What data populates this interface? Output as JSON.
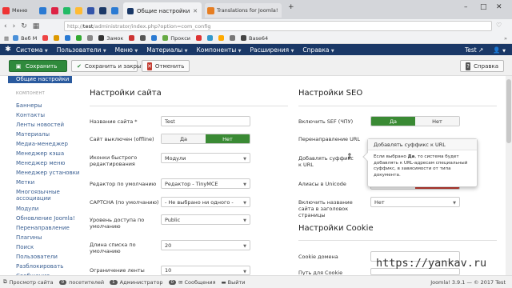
{
  "browser": {
    "tabs_small": [
      {
        "label": "Меню",
        "color": "#e33"
      },
      {
        "label": "",
        "color": "#2a7ad3"
      },
      {
        "label": "",
        "color": "#d24"
      },
      {
        "label": "",
        "color": "#2b6"
      },
      {
        "label": "",
        "color": "#fb3"
      },
      {
        "label": "",
        "color": "#35a"
      },
      {
        "label": "",
        "color": "#1a3867"
      },
      {
        "label": "",
        "color": "#2a7ad3"
      }
    ],
    "tab_active": "Общие настройки ‹ Test",
    "tab_second": "Translations for Joomla!",
    "address_host": "test",
    "address_path": "/administrator/index.php?option=com_config",
    "bookmarks": [
      "Веб М",
      "",
      "",
      "",
      "",
      "",
      "Замок",
      "",
      "",
      "",
      "Прокси",
      "",
      "",
      "",
      "",
      "Base64"
    ]
  },
  "adminnav": {
    "menus": [
      "Система",
      "Пользователи",
      "Меню",
      "Материалы",
      "Компоненты",
      "Расширения",
      "Справка"
    ],
    "site": "Test",
    "user": "user-icon"
  },
  "toolbar": {
    "save": "Сохранить",
    "save_close": "Сохранить и закрыть",
    "cancel": "Отменить",
    "help": "Справка"
  },
  "sidebar": {
    "active": "Общие настройки",
    "heading": "КОМПОНЕНТ",
    "items": [
      "Баннеры",
      "Контакты",
      "Ленты новостей",
      "Материалы",
      "Медиа-менеджер",
      "Менеджер кэша",
      "Менеджер меню",
      "Менеджер установки",
      "Метки",
      "Многоязычные ассоциации",
      "Модули",
      "Обновление Joomla!",
      "Перенаправление",
      "Плагины",
      "Поиск",
      "Пользователи",
      "Разблокировать",
      "Сообщения"
    ]
  },
  "site": {
    "title": "Настройки сайта",
    "name_label": "Название сайта *",
    "name_value": "Test",
    "offline_label": "Сайт выключен (offline)",
    "offline_yes": "Да",
    "offline_no": "Нет",
    "icons_label": "Иконки быстрого редактирования",
    "icons_value": "Модули",
    "editor_label": "Редактор по умолчанию",
    "editor_value": "Редактор - TinyMCE",
    "captcha_label": "CAPTCHA (по умолчанию)",
    "captcha_value": "- Не выбрано ни одного -",
    "access_label": "Уровень доступа по умолчанию",
    "access_value": "Public",
    "list_label": "Длина списка по умолчанию",
    "list_value": "20",
    "feed_label": "Ограничение ленты",
    "feed_value": "10"
  },
  "seo": {
    "title": "Настройки SEO",
    "sef_label": "Включить SEF (ЧПУ)",
    "sef_yes": "Да",
    "sef_no": "Нет",
    "rewrite_label": "Перенаправление URL",
    "suffix_label": "Добавлять суффикс к URL",
    "unicode_label": "Алиасы в Unicode",
    "sitename_label": "Включить название сайта в заголовок страницы",
    "sitename_value": "Нет"
  },
  "cookie": {
    "title": "Настройки Cookie",
    "domain_label": "Cookie домена",
    "path_label": "Путь для Cookie"
  },
  "popover": {
    "title": "Добавлять суффикс к URL",
    "body_pre": "Если выбрано ",
    "body_bold": "Да",
    "body_post": ", то система будет добавлять к URL-адресам специальный суффикс, в зависимости от типа документа."
  },
  "status": {
    "preview": "Просмотр сайта",
    "visitors_count": "0",
    "visitors": "посетителей",
    "admins_count": "1",
    "admins": "Администратор",
    "messages_count": "0",
    "messages": "Сообщения",
    "logout": "Выйти",
    "version": "Joomla! 3.9.1 — © 2017 Test"
  },
  "watermark": "https://yankav.ru",
  "colors": {
    "nav": "#1a3867",
    "green": "#2f8a3c",
    "toggle_on": "#3a8a34",
    "sidebar_active": "#2a5a9e"
  }
}
